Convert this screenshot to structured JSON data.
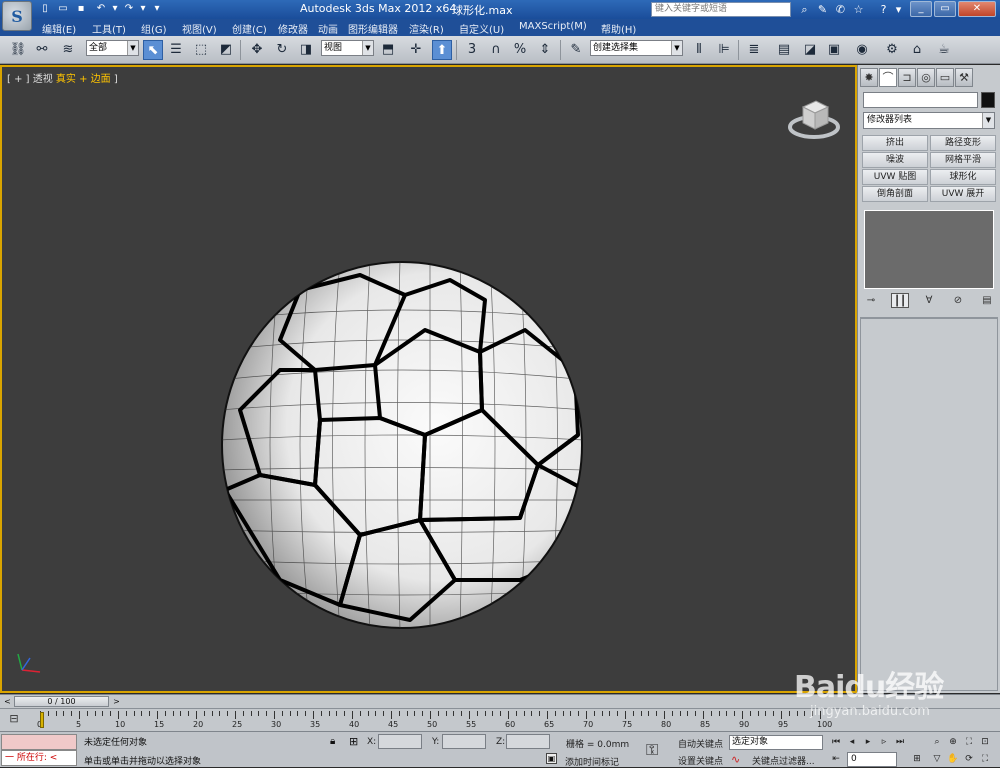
{
  "title_bar": {
    "app_title": "Autodesk 3ds Max  2012 x64",
    "file_name": "球形化.max",
    "search_placeholder": "键入关键字或短语",
    "minimize": "_",
    "restore": "▭",
    "close": "✕"
  },
  "menu": {
    "items": [
      "编辑(E)",
      "工具(T)",
      "组(G)",
      "视图(V)",
      "创建(C)",
      "修改器",
      "动画",
      "图形编辑器",
      "渲染(R)",
      "自定义(U)",
      "MAXScript(M)",
      "帮助(H)"
    ]
  },
  "toolbar": {
    "selection_filter": "全部",
    "ref_coord": "视图",
    "named_selection": "创建选择集"
  },
  "viewport": {
    "label_bracket_open": "[ + ]",
    "label_view": "透视",
    "label_shading": "真实 + 边面",
    "label_bracket_close": "]"
  },
  "command_panel": {
    "modifier_list": "修改器列表",
    "modifier_buttons": [
      "挤出",
      "路径变形",
      "噪波",
      "网格平滑",
      "UVW 贴图",
      "球形化",
      "倒角剖面",
      "UVW 展开"
    ]
  },
  "time_slider": {
    "position": "0 / 100",
    "prev": "<",
    "next": ">"
  },
  "track_bar": {
    "ticks": [
      "0",
      "5",
      "10",
      "15",
      "20",
      "25",
      "30",
      "35",
      "40",
      "45",
      "50",
      "55",
      "60",
      "65",
      "70",
      "75",
      "80",
      "85",
      "90",
      "95",
      "100"
    ]
  },
  "status_bar": {
    "maxscript_output": "一  所在行:  <",
    "selection_status": "未选定任何对象",
    "prompt": "单击或单击并拖动以选择对象",
    "x_label": "X:",
    "y_label": "Y:",
    "z_label": "Z:",
    "grid": "栅格 = 0.0mm",
    "add_time_tag": "添加时间标记",
    "auto_key": "自动关键点",
    "set_key": "设置关键点",
    "selection_set": "选定对象",
    "key_filters": "关键点过滤器...",
    "current_frame": "0"
  },
  "watermark": {
    "text": "Baidu经验",
    "url": "jingyan.baidu.com"
  },
  "colors": {
    "title_bar": "#1f4f98",
    "viewport_bg": "#3d3d3d",
    "active_border": "#d9a400",
    "panel_bg": "#c6cace"
  }
}
